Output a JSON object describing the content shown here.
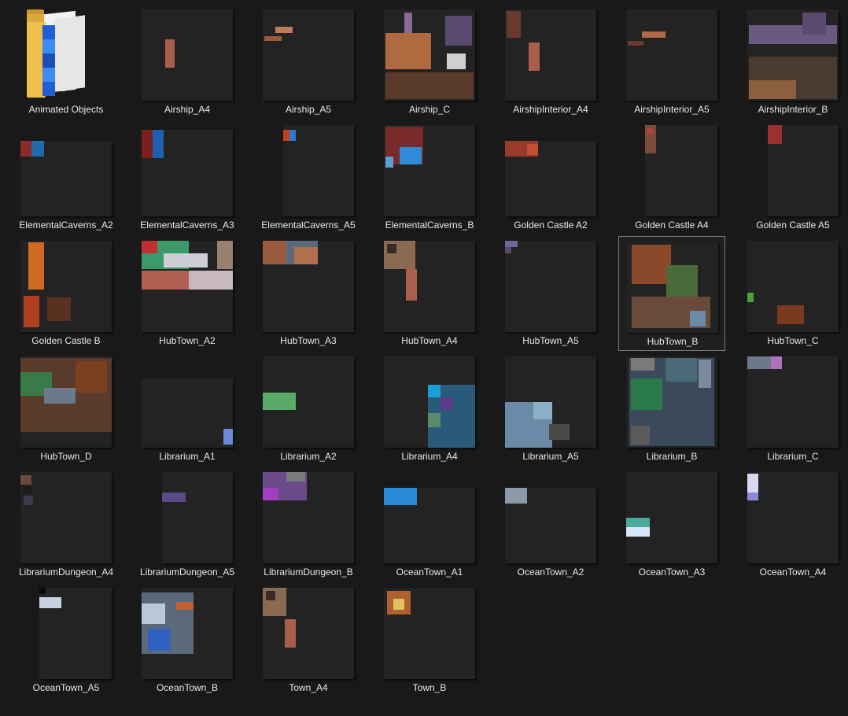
{
  "items": [
    {
      "name": "Animated Objects",
      "kind": "folder"
    },
    {
      "name": "Airship_A4",
      "kind": "sheet"
    },
    {
      "name": "Airship_A5",
      "kind": "sheet"
    },
    {
      "name": "Airship_C",
      "kind": "sheet"
    },
    {
      "name": "AirshipInterior_A4",
      "kind": "sheet"
    },
    {
      "name": "AirshipInterior_A5",
      "kind": "sheet"
    },
    {
      "name": "AirshipInterior_B",
      "kind": "sheet"
    },
    {
      "name": "ElementalCaverns_A2",
      "kind": "sheet"
    },
    {
      "name": "ElementalCaverns_A3",
      "kind": "sheet"
    },
    {
      "name": "ElementalCaverns_A5",
      "kind": "sheet"
    },
    {
      "name": "ElementalCaverns_B",
      "kind": "sheet"
    },
    {
      "name": "Golden Castle A2",
      "kind": "sheet"
    },
    {
      "name": "Golden Castle A4",
      "kind": "sheet"
    },
    {
      "name": "Golden Castle A5",
      "kind": "sheet"
    },
    {
      "name": "Golden Castle B",
      "kind": "sheet"
    },
    {
      "name": "HubTown_A2",
      "kind": "sheet"
    },
    {
      "name": "HubTown_A3",
      "kind": "sheet"
    },
    {
      "name": "HubTown_A4",
      "kind": "sheet"
    },
    {
      "name": "HubTown_A5",
      "kind": "sheet"
    },
    {
      "name": "HubTown_B",
      "kind": "sheet",
      "selected": true
    },
    {
      "name": "HubTown_C",
      "kind": "sheet"
    },
    {
      "name": "HubTown_D",
      "kind": "sheet"
    },
    {
      "name": "Librarium_A1",
      "kind": "sheet"
    },
    {
      "name": "Librarium_A2",
      "kind": "sheet"
    },
    {
      "name": "Librarium_A4",
      "kind": "sheet"
    },
    {
      "name": "Librarium_A5",
      "kind": "sheet"
    },
    {
      "name": "Librarium_B",
      "kind": "sheet"
    },
    {
      "name": "Librarium_C",
      "kind": "sheet"
    },
    {
      "name": "LibrariumDungeon_A4",
      "kind": "sheet"
    },
    {
      "name": "LibrariumDungeon_A5",
      "kind": "sheet"
    },
    {
      "name": "LibrariumDungeon_B",
      "kind": "sheet"
    },
    {
      "name": "OceanTown_A1",
      "kind": "sheet"
    },
    {
      "name": "OceanTown_A2",
      "kind": "sheet"
    },
    {
      "name": "OceanTown_A3",
      "kind": "sheet"
    },
    {
      "name": "OceanTown_A4",
      "kind": "sheet"
    },
    {
      "name": "OceanTown_A5",
      "kind": "sheet"
    },
    {
      "name": "OceanTown_B",
      "kind": "sheet"
    },
    {
      "name": "Town_A4",
      "kind": "sheet"
    },
    {
      "name": "Town_B",
      "kind": "sheet"
    }
  ],
  "colors": {
    "background": "#191919",
    "label": "#e8e8e8",
    "selection_border": "#7a7a7a"
  }
}
